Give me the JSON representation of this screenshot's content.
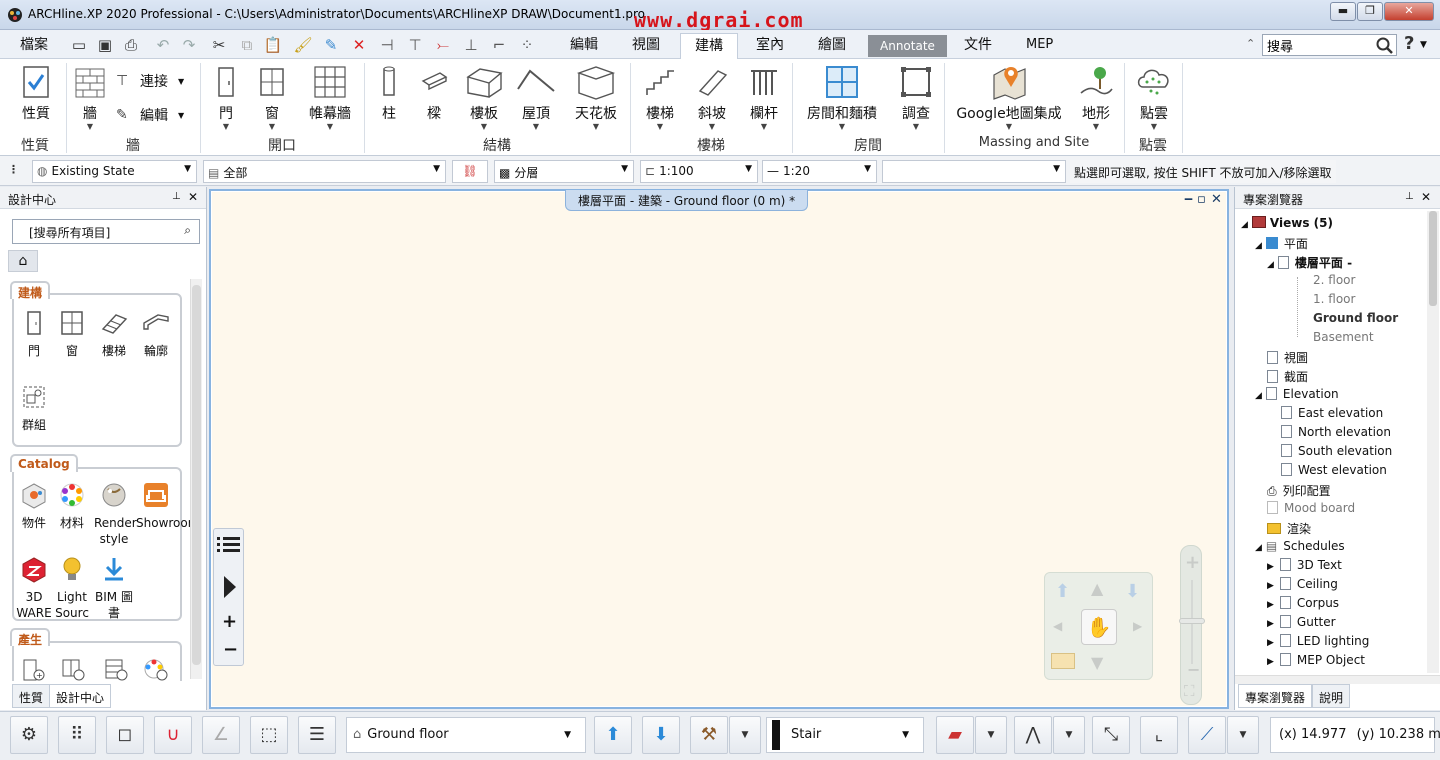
{
  "window": {
    "title": "ARCHline.XP 2020  Professional - C:\\Users\\Administrator\\Documents\\ARCHlineXP DRAW\\Document1.pro",
    "watermark": "www.dgrai.com",
    "min_label": "▬",
    "max_label": "❐",
    "close_label": "✕"
  },
  "menubar": {
    "file_label": "檔案",
    "tabs": [
      {
        "label": "編輯"
      },
      {
        "label": "視圖"
      },
      {
        "label": "建構"
      },
      {
        "label": "室內"
      },
      {
        "label": "繪圖"
      },
      {
        "label": "Annotate"
      },
      {
        "label": "文件"
      },
      {
        "label": "MEP"
      }
    ],
    "search_value": "搜尋",
    "help": "?"
  },
  "ribbon": {
    "buttons": {
      "properties": "性質",
      "wall": "牆",
      "connect": "連接",
      "edit": "編輯",
      "door": "門",
      "window": "窗",
      "curtain_wall": "帷幕牆",
      "column": "柱",
      "beam": "樑",
      "slab": "樓板",
      "roof": "屋頂",
      "ceiling": "天花板",
      "stair": "樓梯",
      "ramp": "斜坡",
      "railing": "欄杆",
      "room_area": "房間和麵積",
      "survey": "調查",
      "google_map": "Google地圖集成",
      "terrain": "地形",
      "point_cloud": "點雲"
    },
    "groups": {
      "properties": "性質",
      "wall": "牆",
      "openings": "開口",
      "structure": "結構",
      "stairs": "樓梯",
      "room": "房間",
      "massing": "Massing and Site",
      "point_cloud": "點雲"
    }
  },
  "optionbar": {
    "state": "Existing State",
    "layer_all": "全部",
    "layers": "分層",
    "scale1": "1:100",
    "scale2": "1:20",
    "hint": "點選即可選取, 按住 SHIFT 不放可加入/移除選取"
  },
  "leftpanel": {
    "title": "設計中心",
    "search_placeholder": "[搜尋所有項目]",
    "sections": {
      "build": {
        "title": "建構",
        "items": [
          "門",
          "窗",
          "樓梯",
          "輪廓",
          "群組"
        ]
      },
      "catalog": {
        "title": "Catalog",
        "items": [
          "物件",
          "材料",
          "Render style",
          "Showroom",
          "3D WARE",
          "Light Sourc",
          "BIM 圖書"
        ]
      },
      "generate": {
        "title": "產生"
      }
    },
    "tabs": [
      "性質",
      "設計中心"
    ]
  },
  "canvas": {
    "tab_title": "樓層平面 - 建築 - Ground floor (0 m) *",
    "background": "#fef8ec"
  },
  "rightpanel": {
    "title": "專案瀏覽器",
    "tree": {
      "views": "Views (5)",
      "plan": "平面",
      "floor_plan": "樓層平面 -",
      "floors": [
        "2. floor",
        "1. floor",
        "Ground floor",
        "Basement"
      ],
      "view": "視圖",
      "section": "截面",
      "elevation": "Elevation",
      "elevations": [
        "East elevation",
        "North elevation",
        "South elevation",
        "West elevation"
      ],
      "print_layout": "列印配置",
      "mood_board": "Mood board",
      "render": "渲染",
      "schedules": "Schedules",
      "schedule_items": [
        "3D Text",
        "Ceiling",
        "Corpus",
        "Gutter",
        "LED lighting",
        "MEP Object"
      ]
    },
    "tabs": [
      "專案瀏覽器",
      "說明"
    ]
  },
  "statusbar": {
    "floor": "Ground floor",
    "element": "Stair",
    "x_label": "(x)",
    "x_value": "14.977",
    "y_label": "(y)",
    "y_value": "10.238 m"
  },
  "colors": {
    "accent": "#1e5fa8",
    "orange_label": "#c05a1a",
    "canvas_border": "#88b3e0"
  }
}
